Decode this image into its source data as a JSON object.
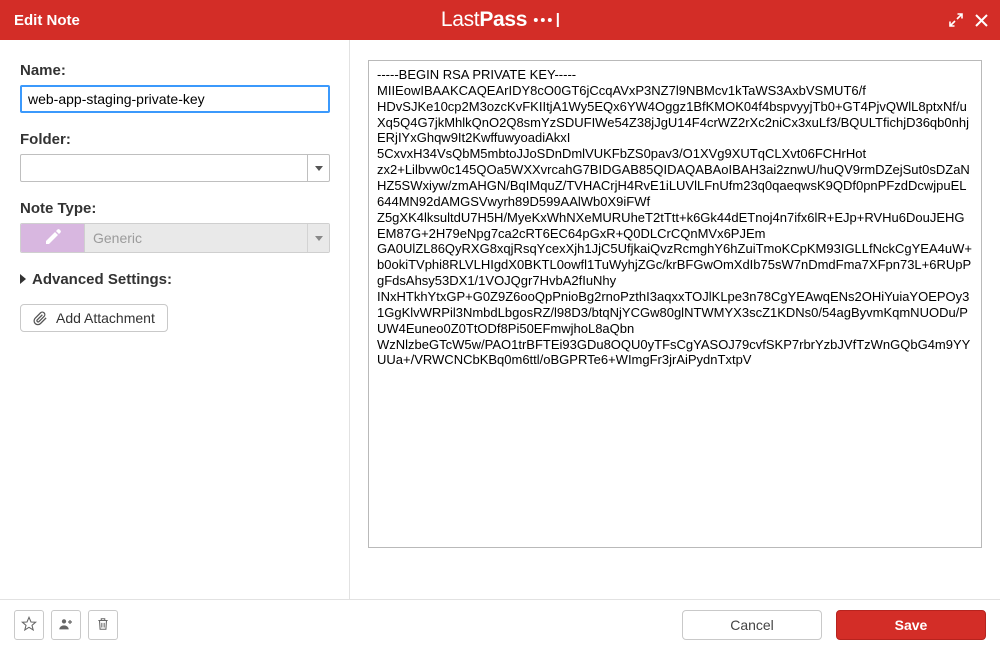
{
  "header": {
    "title": "Edit Note",
    "brand_left": "Last",
    "brand_right": "Pass"
  },
  "form": {
    "name_label": "Name:",
    "name_value": "web-app-staging-private-key",
    "folder_label": "Folder:",
    "folder_value": "",
    "note_type_label": "Note Type:",
    "note_type_value": "Generic",
    "advanced_label": "Advanced Settings:",
    "attach_label": "Add Attachment"
  },
  "note_content": "-----BEGIN RSA PRIVATE KEY-----\nMIIEowIBAAKCAQEArIDY8cO0GT6jCcqAVxP3NZ7l9NBMcv1kTaWS3AxbVSMUT6/f\nHDvSJKe10cp2M3ozcKvFKIItjA1Wy5EQx6YW4Oggz1BfKMOK04f4bspvyyjTb0+GT4PjvQWlL8ptxNf/uXq5Q4G7jkMhlkQnO2Q8smYzSDUFIWe54Z38jJgU14F4crWZ2rXc2niCx3xuLf3/BQULTfichjD36qb0nhjERjIYxGhqw9It2KwffuwyoadiAkxI\n5CxvxH34VsQbM5mbtoJJoSDnDmlVUKFbZS0pav3/O1XVg9XUTqCLXvt06FCHrHot\nzx2+Lilbvw0c145QOa5WXXvrcahG7BIDGAB85QIDAQABAoIBAH3ai2znwU/huQV9rmDZejSut0sDZaNHZ5SWxiyw/zmAHGN/BqIMquZ/TVHACrjH4RvE1iLUVlLFnUfm23q0qaeqwsK9QDf0pnPFzdDcwjpuEL644MN92dAMGSVwyrh89D599AAlWb0X9iFWf\nZ5gXK4lksultdU7H5H/MyeKxWhNXeMURUheT2tTtt+k6Gk44dETnoj4n7ifx6lR+EJp+RVHu6DouJEHGEM87G+2H79eNpg7ca2cRT6EC64pGxR+Q0DLCrCQnMVx6PJEm\nGA0UlZL86QyRXG8xqjRsqYcexXjh1JjC5UfjkaiQvzRcmghY6hZuiTmoKCpKM93IGLLfNckCgYEA4uW+b0okiTVphi8RLVLHIgdX0BKTL0owfl1TuWyhjZGc/krBFGwOmXdIb75sW7nDmdFma7XFpn73L+6RUpPgFdsAhsy53DX1/1VOJQgr7HvbA2fIuNhy\nINxHTkhYtxGP+G0Z9Z6ooQpPnioBg2rnoPzthI3aqxxTOJlKLpe3n78CgYEAwqENs2OHiYuiaYOEPOy31GgKlvWRPil3NmbdLbgosRZ/l98D3/btqNjYCGw80glNTWMYX3scZ1KDNs0/54agByvmKqmNUODu/PUW4Euneo0Z0TtODf8Pi50EFmwjhoL8aQbn\nWzNlzbeGTcW5w/PAO1trBFTEi93GDu8OQU0yTFsCgYASOJ79cvfSKP7rbrYzbJVfTzWnGQbG4m9YYUUa+/VRWCNCbKBq0m6ttl/oBGPRTe6+WImgFr3jrAiPydnTxtpV",
  "footer": {
    "cancel_label": "Cancel",
    "save_label": "Save"
  }
}
